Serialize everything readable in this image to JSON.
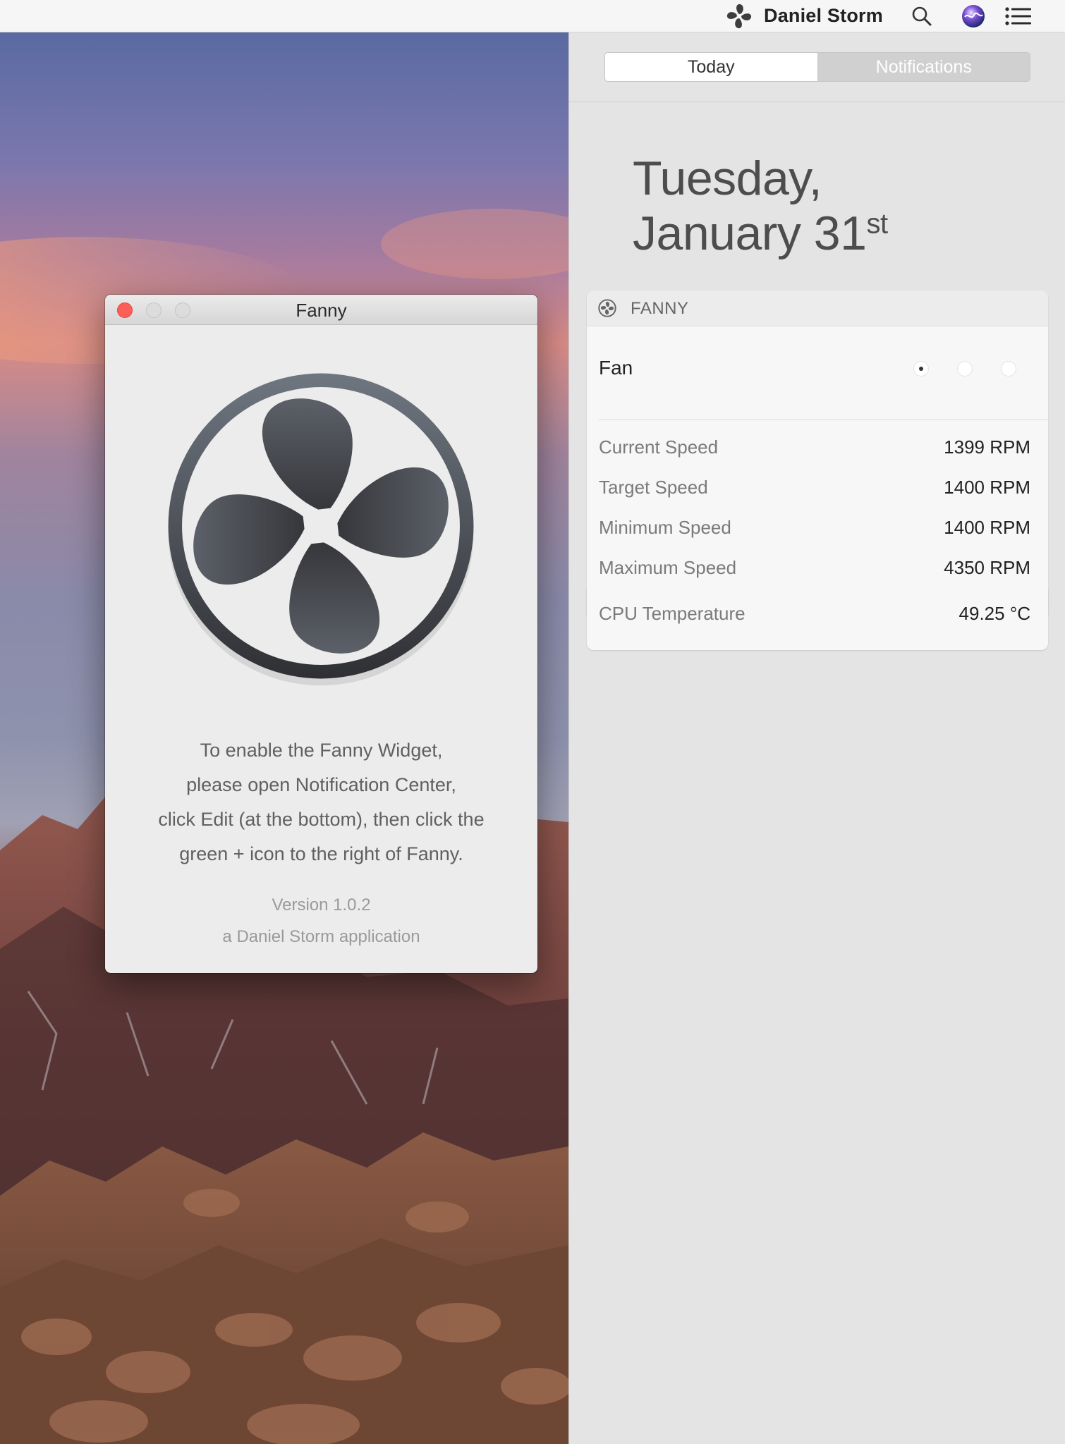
{
  "menubar": {
    "user_name": "Daniel Storm",
    "icons": [
      "fan-icon",
      "search-icon",
      "siri-icon",
      "notification-center-icon"
    ]
  },
  "window": {
    "title": "Fanny",
    "instructions": [
      "To enable the Fanny Widget,",
      "please open Notification Center,",
      "click Edit (at the bottom), then click the",
      "green + icon to the right of Fanny."
    ],
    "version": "Version 1.0.2",
    "byline": "a Daniel Storm application"
  },
  "notification_center": {
    "tabs": {
      "today": "Today",
      "notifications": "Notifications"
    },
    "date": {
      "weekday": "Tuesday,",
      "month_day": "January 31",
      "suffix": "st"
    },
    "widget": {
      "title": "FANNY",
      "fan_label": "Fan",
      "page_dots": {
        "count": 3,
        "selected": 1
      },
      "rows": [
        {
          "label": "Current Speed",
          "value": "1399 RPM"
        },
        {
          "label": "Target Speed",
          "value": "1400 RPM"
        },
        {
          "label": "Minimum Speed",
          "value": "1400 RPM"
        },
        {
          "label": "Maximum Speed",
          "value": "4350 RPM"
        }
      ],
      "temperature": {
        "label": "CPU Temperature",
        "value": "49.25 °C"
      }
    }
  },
  "colors": {
    "close_button": "#fc5f57",
    "fan_icon_dark": "#3a3b40",
    "panel_background": "#e4e4e4"
  }
}
